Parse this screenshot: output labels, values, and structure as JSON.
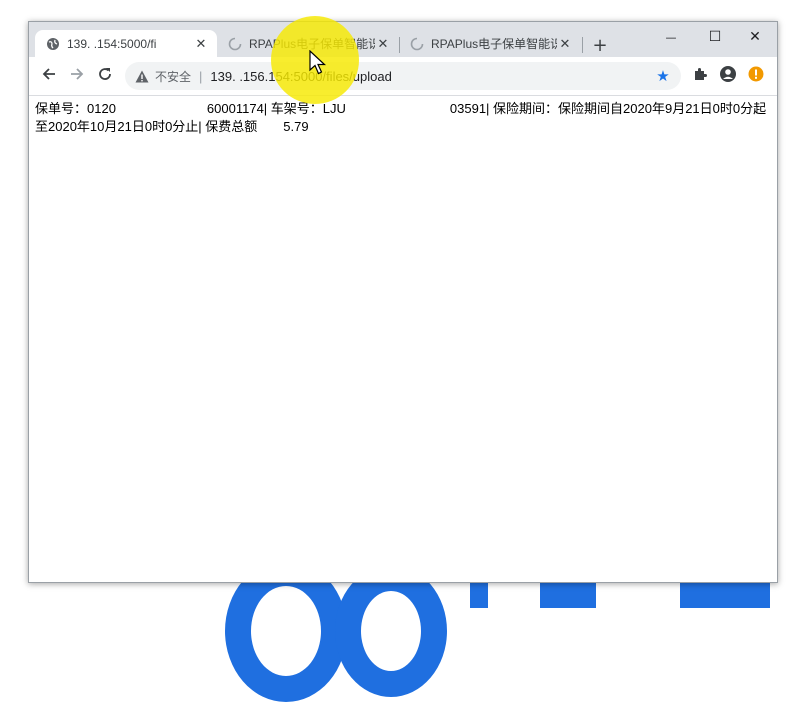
{
  "tabs": [
    {
      "title": "139.   .154:5000/fi",
      "active": true,
      "icon": "globe-icon"
    },
    {
      "title": "RPAPlus电子保单智能识别",
      "active": false,
      "icon": "loading-icon"
    },
    {
      "title": "RPAPlus电子保单智能识别",
      "active": false,
      "icon": "loading-icon"
    }
  ],
  "new_tab_label": "+",
  "window_controls": {
    "minimize": "—",
    "maximize": "☐",
    "close": "✕"
  },
  "toolbar": {
    "security_label": "不安全",
    "url": "139.   .156.154:5000/files/upload"
  },
  "page": {
    "text": "保单号：0120　　　　　　　60001174| 车架号：LJU　　　　　　　　03591| 保险期间：保险期间自2020年9月21日0时0分起至2020年10月21日0时0分止| 保费总额　　5.79"
  },
  "colors": {
    "accent": "#1a73e8",
    "cursor_highlight": "#f6e900",
    "extension_badge": "#f29900"
  }
}
